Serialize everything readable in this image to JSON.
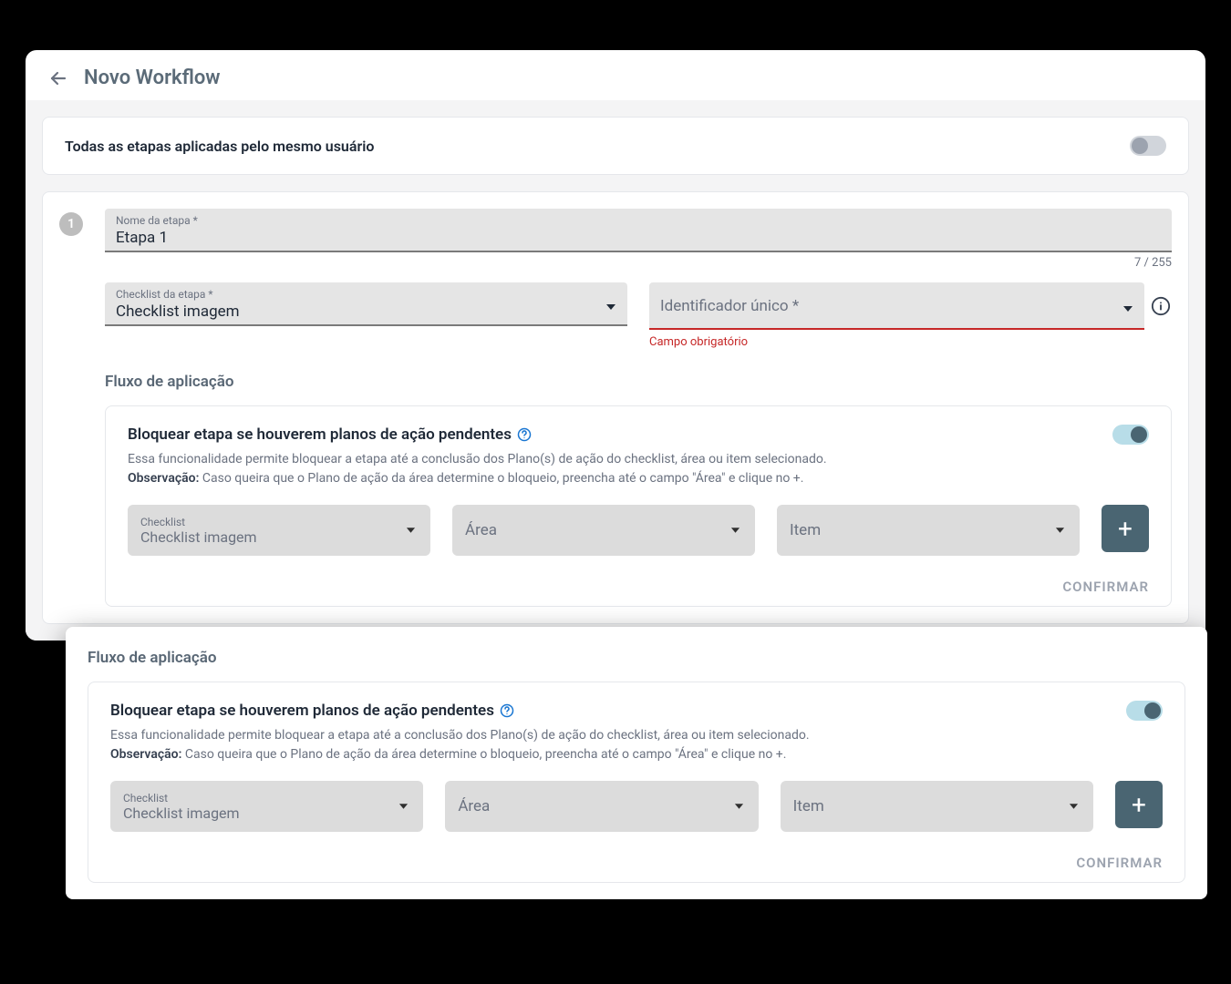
{
  "header": {
    "title": "Novo Workflow"
  },
  "sameUser": {
    "label": "Todas as etapas aplicadas pelo mesmo usuário",
    "on": false
  },
  "step": {
    "number": "1",
    "name": {
      "label": "Nome da etapa *",
      "value": "Etapa 1",
      "count": "7 / 255"
    },
    "checklist": {
      "label": "Checklist da etapa *",
      "value": "Checklist imagem"
    },
    "identifier": {
      "label": "Identificador único *",
      "error": "Campo obrigatório"
    },
    "flowTitle": "Fluxo de aplicação",
    "block": {
      "title": "Bloquear etapa se houverem planos de ação pendentes",
      "desc1": "Essa funcionalidade permite bloquear a etapa até a conclusão dos Plano(s) de ação do checklist, área ou item selecionado.",
      "obsLabel": "Observação:",
      "obsText": " Caso queira que o Plano de ação da área determine o bloqueio, preencha até o campo \"Área\" e clique no +.",
      "filters": {
        "checklist": {
          "label": "Checklist",
          "value": "Checklist imagem"
        },
        "area": {
          "label": "Área"
        },
        "item": {
          "label": "Item"
        }
      },
      "confirm": "CONFIRMAR"
    }
  },
  "overlay": {
    "flowTitle": "Fluxo de aplicação",
    "block": {
      "title": "Bloquear etapa se houverem planos de ação pendentes",
      "desc1": "Essa funcionalidade permite bloquear a etapa até a conclusão dos Plano(s) de ação do checklist, área ou item selecionado.",
      "obsLabel": "Observação:",
      "obsText": " Caso queira que o Plano de ação da área determine o bloqueio, preencha até o campo \"Área\" e clique no +.",
      "filters": {
        "checklist": {
          "label": "Checklist",
          "value": "Checklist imagem"
        },
        "area": {
          "label": "Área"
        },
        "item": {
          "label": "Item"
        }
      },
      "confirm": "CONFIRMAR"
    }
  }
}
